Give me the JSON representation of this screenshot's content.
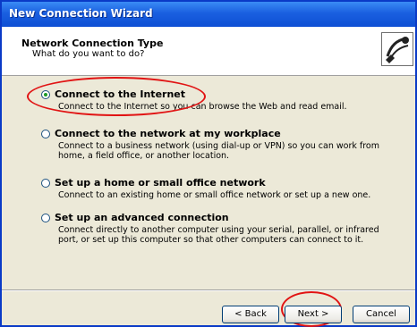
{
  "window": {
    "title": "New Connection Wizard"
  },
  "header": {
    "title": "Network Connection Type",
    "subtitle": "What do you want to do?",
    "icon": "network-wizard-icon"
  },
  "options": [
    {
      "label": "Connect to the Internet",
      "description": "Connect to the Internet so you can browse the Web and read email.",
      "selected": true
    },
    {
      "label": "Connect to the network at my workplace",
      "description": "Connect to a business network (using dial-up or VPN) so you can work from home, a field office, or another location.",
      "selected": false
    },
    {
      "label": "Set up a home or small office network",
      "description": "Connect to an existing home or small office network or set up a new one.",
      "selected": false
    },
    {
      "label": "Set up an advanced connection",
      "description": "Connect directly to another computer using your serial, parallel, or infrared port, or set up this computer so that other computers can connect to it.",
      "selected": false
    }
  ],
  "buttons": {
    "back": "< Back",
    "next": "Next >",
    "cancel": "Cancel"
  },
  "colors": {
    "titlebar": "#1a5fe0",
    "annotation": "#e11414",
    "radio_dot": "#1f9a26"
  }
}
